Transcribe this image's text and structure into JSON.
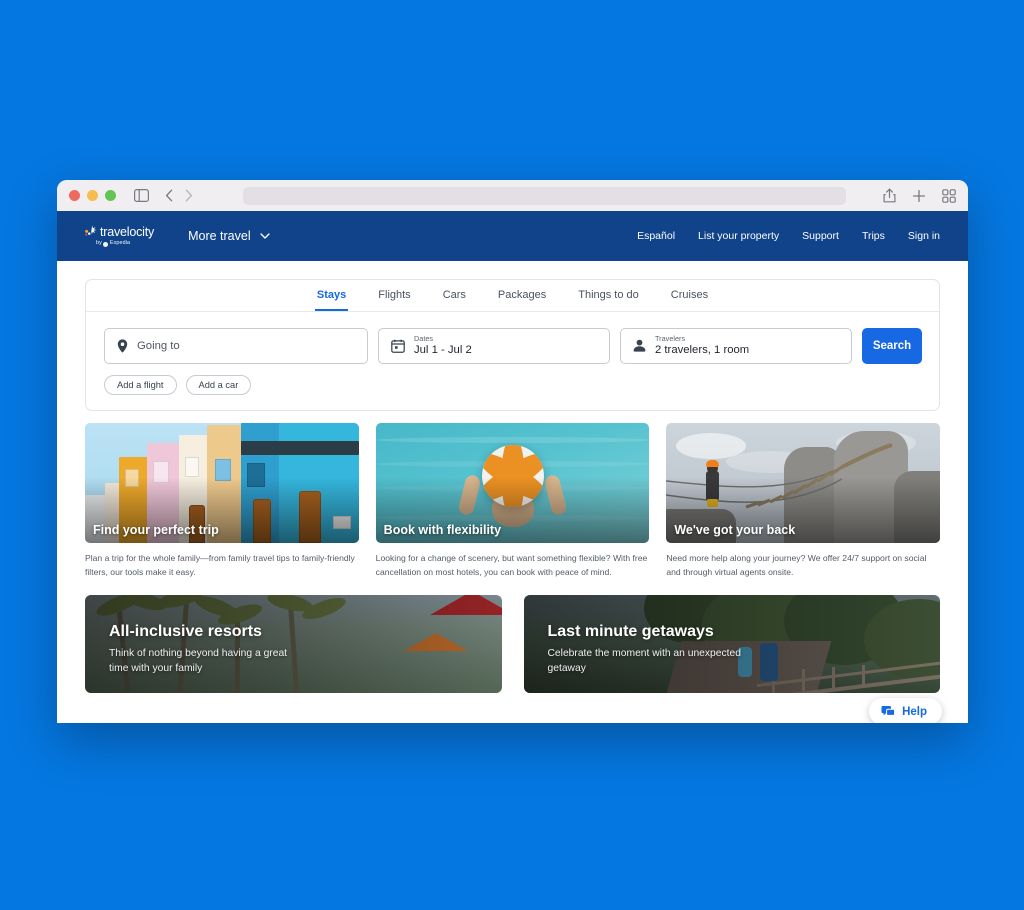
{
  "background_color": "#0577e0",
  "browser": {
    "traffic_lights": [
      "close-red",
      "minimize-yellow",
      "maximize-green"
    ],
    "sidebar_toggle": "sidebar-icon",
    "back": "chevron-left-icon",
    "forward": "chevron-right-icon",
    "url_value": "",
    "url_placeholder": "",
    "share": "share-icon",
    "new_tab": "plus-icon",
    "tab_overview": "grid-icon"
  },
  "header": {
    "brand_name": "travelocity",
    "brand_sub": "by",
    "brand_sub2": "Expedia",
    "more_travel": "More travel",
    "nav": [
      {
        "label": "Español"
      },
      {
        "label": "List your property"
      },
      {
        "label": "Support"
      },
      {
        "label": "Trips"
      },
      {
        "label": "Sign in"
      }
    ]
  },
  "search": {
    "tabs": [
      {
        "label": "Stays",
        "active": true
      },
      {
        "label": "Flights",
        "active": false
      },
      {
        "label": "Cars",
        "active": false
      },
      {
        "label": "Packages",
        "active": false
      },
      {
        "label": "Things to do",
        "active": false
      },
      {
        "label": "Cruises",
        "active": false
      }
    ],
    "destination": {
      "icon": "map-pin-icon",
      "placeholder": "Going to",
      "value": ""
    },
    "dates": {
      "icon": "calendar-icon",
      "label": "Dates",
      "value": "Jul 1 - Jul 2"
    },
    "travelers": {
      "icon": "person-icon",
      "label": "Travelers",
      "value": "2 travelers, 1 room"
    },
    "search_button": "Search",
    "chips": [
      {
        "label": "Add a flight"
      },
      {
        "label": "Add a car"
      }
    ]
  },
  "cards3": [
    {
      "title": "Find your perfect trip",
      "desc": "Plan a trip for the whole family—from family travel tips to family-friendly filters, our tools make it easy."
    },
    {
      "title": "Book with flexibility",
      "desc": "Looking for a change of scenery, but want something flexible? With free cancellation on most hotels, you can book with peace of mind."
    },
    {
      "title": "We've got your back",
      "desc": "Need more help along your journey? We offer 24/7 support on social and through virtual agents onsite."
    }
  ],
  "cards2": [
    {
      "title": "All-inclusive resorts",
      "desc": "Think of nothing beyond having a great time with your family"
    },
    {
      "title": "Last minute getaways",
      "desc": "Celebrate the moment with an unexpected getaway"
    }
  ],
  "help": {
    "icon": "chat-icon",
    "label": "Help"
  },
  "colors": {
    "page_background": "#0577e0",
    "header_navy": "#10438a",
    "accent_blue": "#1668e3",
    "titlebar": "#f0eef1"
  }
}
